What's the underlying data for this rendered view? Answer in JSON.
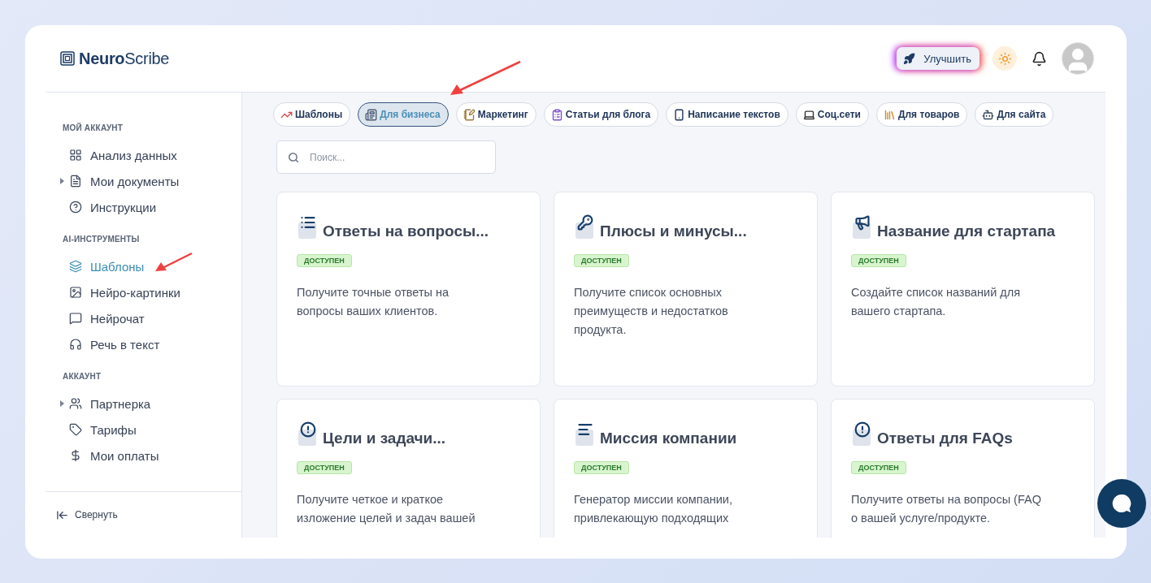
{
  "brand": {
    "bold": "Neuro",
    "light": "Scribe"
  },
  "header": {
    "upgrade_label": "Улучшить"
  },
  "sidebar": {
    "sections": [
      {
        "title": "МОЙ АККАУНТ",
        "items": [
          {
            "label": "Анализ данных",
            "expandable": false,
            "selected": false
          },
          {
            "label": "Мои документы",
            "expandable": true,
            "selected": false
          },
          {
            "label": "Инструкции",
            "expandable": false,
            "selected": false
          }
        ]
      },
      {
        "title": "AI-ИНСТРУМЕНТЫ",
        "items": [
          {
            "label": "Шаблоны",
            "expandable": false,
            "selected": true
          },
          {
            "label": "Нейро-картинки",
            "expandable": false,
            "selected": false
          },
          {
            "label": "Нейрочат",
            "expandable": false,
            "selected": false
          },
          {
            "label": "Речь в текст",
            "expandable": false,
            "selected": false
          }
        ]
      },
      {
        "title": "АККАУНТ",
        "items": [
          {
            "label": "Партнерка",
            "expandable": true,
            "selected": false
          },
          {
            "label": "Тарифы",
            "expandable": false,
            "selected": false
          },
          {
            "label": "Мои оплаты",
            "expandable": false,
            "selected": false
          }
        ]
      }
    ],
    "collapse_label": "Свернуть"
  },
  "tabs": [
    {
      "label": "Шаблоны",
      "selected": false
    },
    {
      "label": "Для бизнеса",
      "selected": true
    },
    {
      "label": "Маркетинг",
      "selected": false
    },
    {
      "label": "Статьи для блога",
      "selected": false
    },
    {
      "label": "Написание текстов",
      "selected": false
    },
    {
      "label": "Соц.сети",
      "selected": false
    },
    {
      "label": "Для товаров",
      "selected": false
    },
    {
      "label": "Для сайта",
      "selected": false
    }
  ],
  "search": {
    "placeholder": "Поиск..."
  },
  "cards": [
    {
      "title": "Ответы на вопросы...",
      "badge": "ДОСТУПЕН",
      "description": "Получите точные ответы на вопросы ваших клиентов."
    },
    {
      "title": "Плюсы и минусы...",
      "badge": "ДОСТУПЕН",
      "description": "Получите список основных преимуществ и недостатков продукта."
    },
    {
      "title": "Название для стартапа",
      "badge": "ДОСТУПЕН",
      "description": "Создайте список названий для вашего стартапа."
    },
    {
      "title": "Цели и задачи...",
      "badge": "ДОСТУПЕН",
      "description": "Получите четкое и краткое изложение целей и задач вашей"
    },
    {
      "title": "Миссия компании",
      "badge": "ДОСТУПЕН",
      "description": "Генератор миссии компании, привлекающую подходящих"
    },
    {
      "title": "Ответы для FAQs",
      "badge": "ДОСТУПЕН",
      "description": "Получите ответы на вопросы (FAQ о вашей услуге/продукте."
    }
  ]
}
